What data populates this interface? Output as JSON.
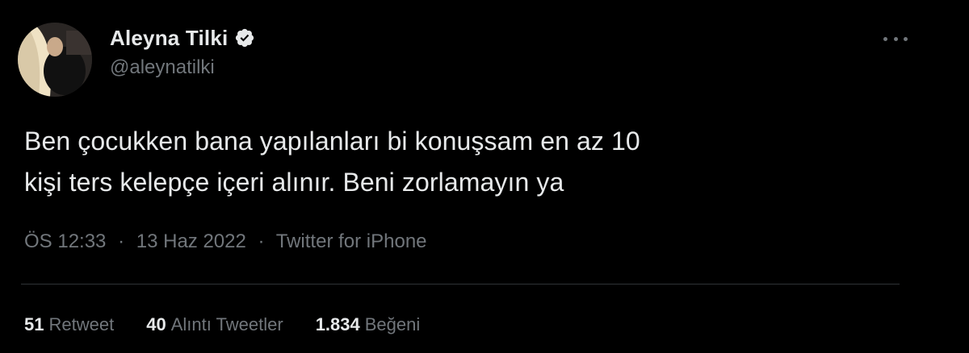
{
  "tweet": {
    "author": {
      "display_name": "Aleyna Tilki",
      "handle": "@aleynatilki",
      "verified_icon": "verified-badge-icon"
    },
    "text_lines": [
      "Ben çocukken bana yapılanları bi konuşsam en az 10",
      "kişi ters kelepçe içeri alınır. Beni zorlamayın ya"
    ],
    "meta": {
      "time": "ÖS 12:33",
      "date": "13 Haz 2022",
      "source": "Twitter for iPhone",
      "separator": "·"
    },
    "stats": {
      "retweets_count": "51",
      "retweets_label": "Retweet",
      "quotes_count": "40",
      "quotes_label": "Alıntı Tweetler",
      "likes_count": "1.834",
      "likes_label": "Beğeni"
    },
    "more_icon": "more-options-icon"
  },
  "colors": {
    "background": "#000000",
    "primary_text": "#e7e9ea",
    "secondary_text": "#71767b",
    "verified": "#e7e9ea",
    "divider": "#2f3336"
  }
}
